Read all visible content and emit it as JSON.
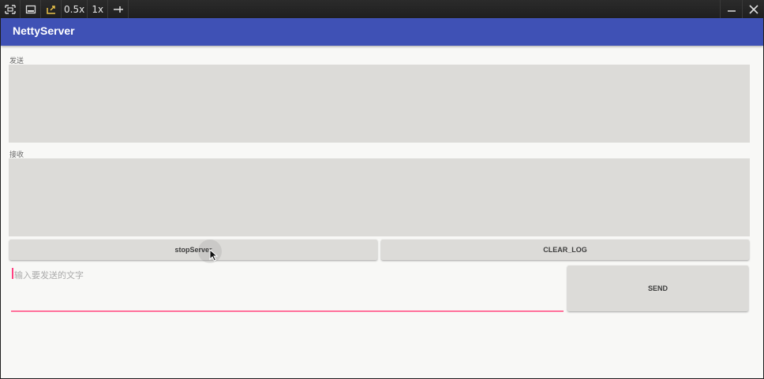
{
  "toolbar": {
    "zoom_half": "0.5x",
    "zoom_one": "1x"
  },
  "app": {
    "title": "NettyServer"
  },
  "send_section": {
    "label": "发送"
  },
  "receive_section": {
    "label": "接收"
  },
  "buttons": {
    "stop_server": "stopServer",
    "clear_log": "CLEAR_LOG",
    "send": "SEND"
  },
  "message_input": {
    "placeholder": "输入要发送的文字",
    "value": ""
  },
  "colors": {
    "appbar": "#3f51b5",
    "accent": "#ff4081",
    "background": "#f8f8f6",
    "surface": "#dcdbd8"
  }
}
